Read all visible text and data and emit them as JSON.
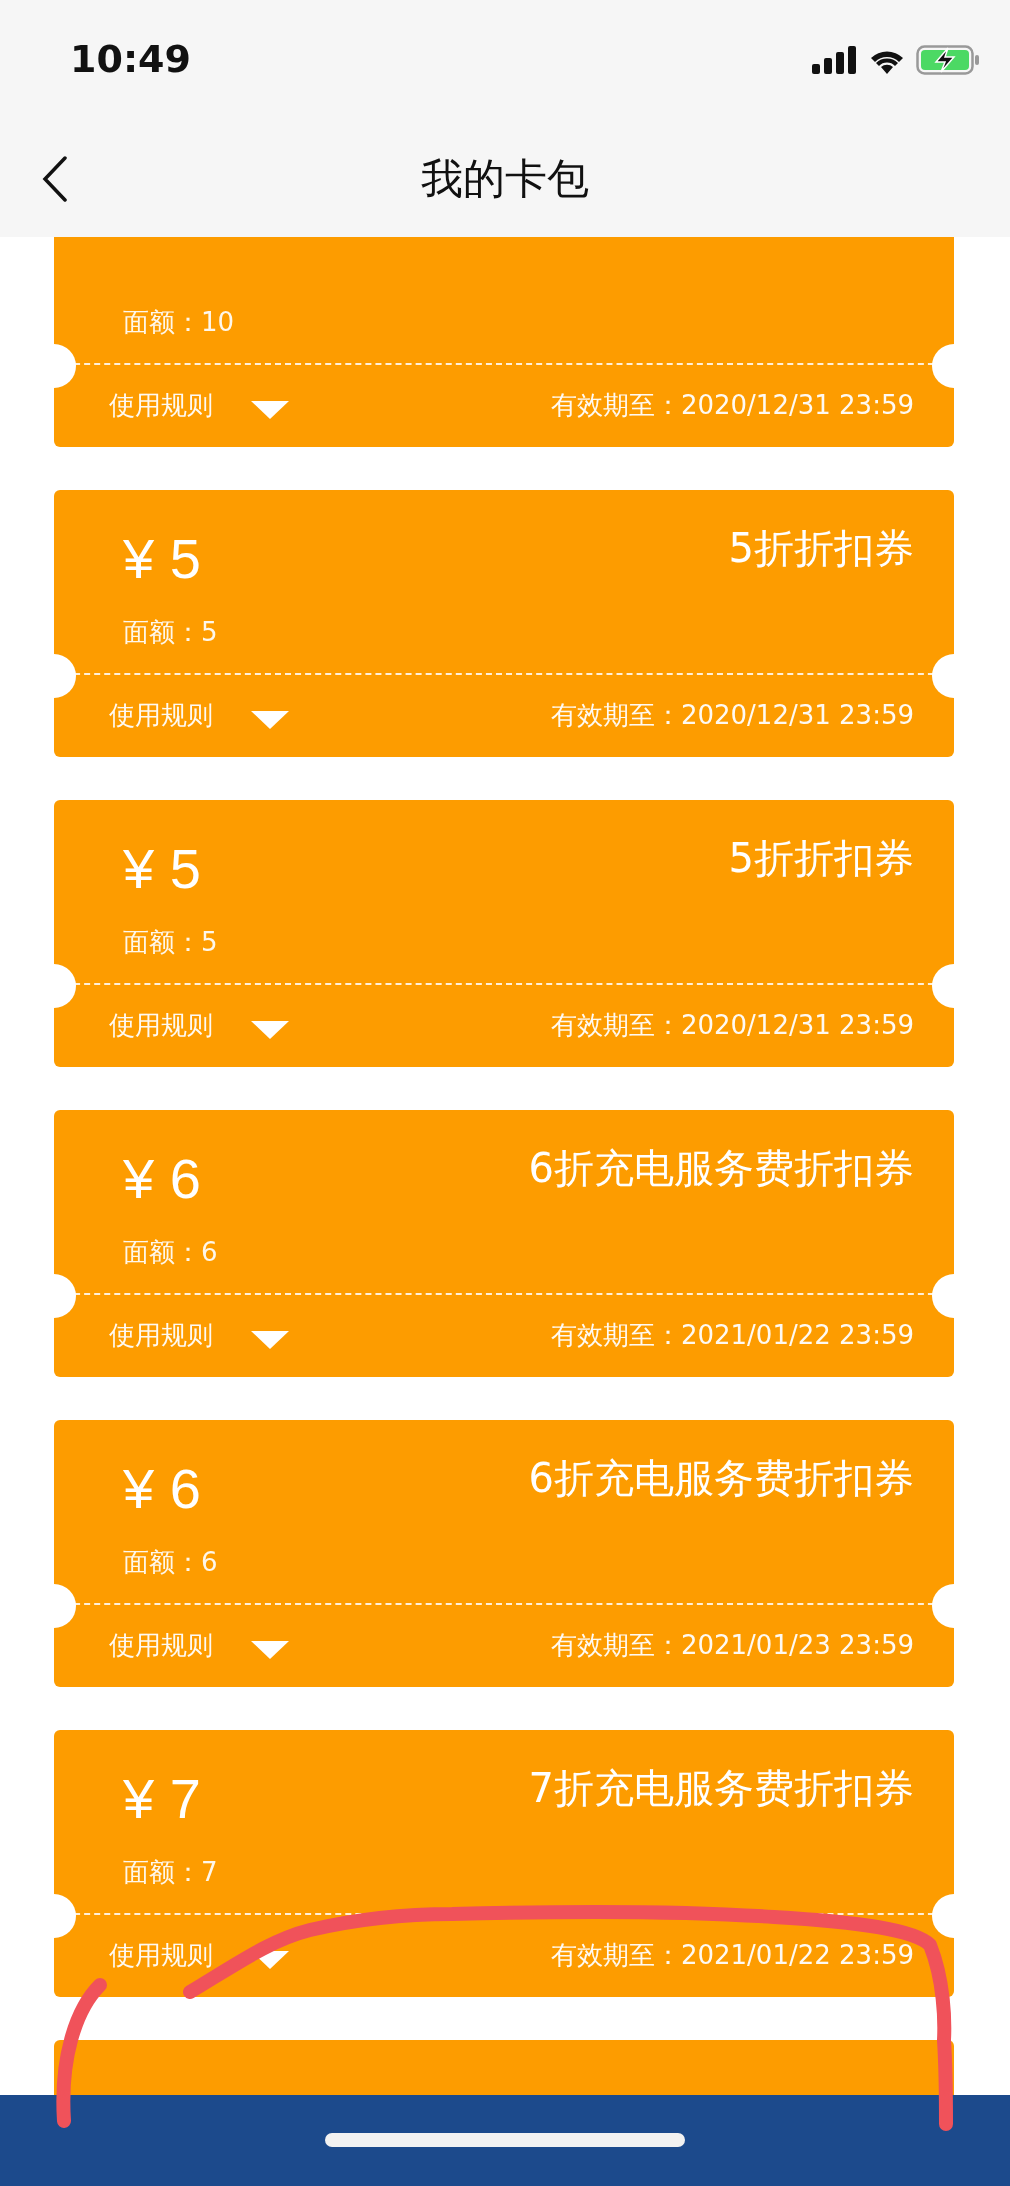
{
  "status_bar": {
    "time": "10:49"
  },
  "nav_bar": {
    "title": "我的卡包"
  },
  "coupons": [
    {
      "kind": "full",
      "face_value": "面额：10",
      "rules": "使用规则",
      "expiry": "有效期至：2020/12/31 23:59"
    },
    {
      "amount": "¥ 5",
      "face_value": "面额：5",
      "name": "5折折扣券",
      "rules": "使用规则",
      "expiry": "有效期至：2020/12/31 23:59"
    },
    {
      "amount": "¥ 5",
      "face_value": "面额：5",
      "name": "5折折扣券",
      "rules": "使用规则",
      "expiry": "有效期至：2020/12/31 23:59"
    },
    {
      "amount": "¥ 6",
      "face_value": "面额：6",
      "name": "6折充电服务费折扣券",
      "rules": "使用规则",
      "expiry": "有效期至：2021/01/22 23:59"
    },
    {
      "amount": "¥ 6",
      "face_value": "面额：6",
      "name": "6折充电服务费折扣券",
      "rules": "使用规则",
      "expiry": "有效期至：2021/01/23 23:59"
    },
    {
      "amount": "¥ 7",
      "face_value": "面额：7",
      "name": "7折充电服务费折扣券",
      "rules": "使用规则",
      "expiry": "有效期至：2021/01/22 23:59"
    },
    {
      "kind": "cut_off"
    }
  ]
}
